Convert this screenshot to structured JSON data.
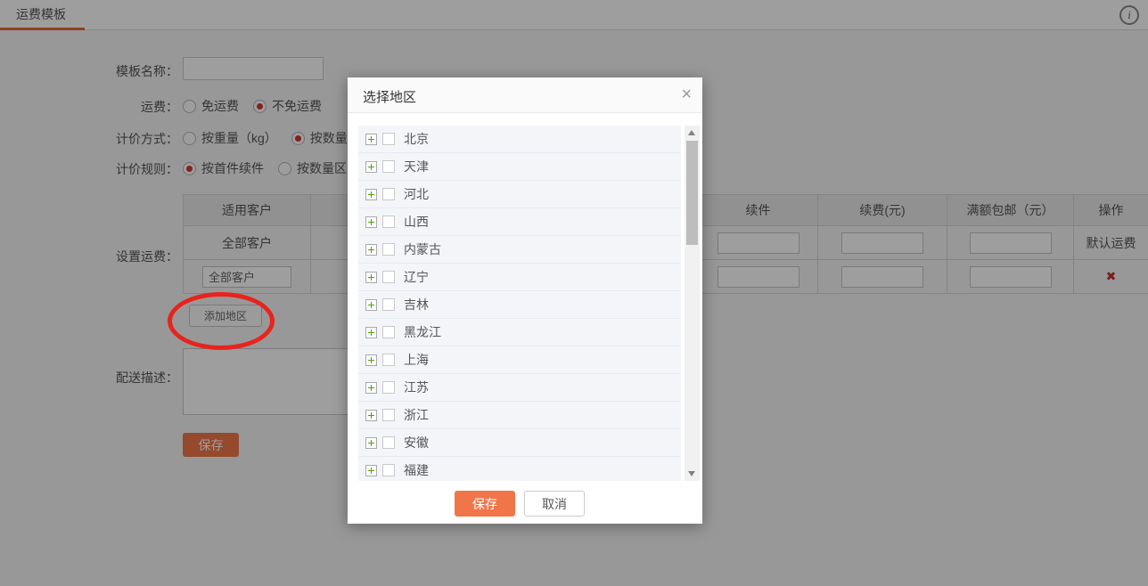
{
  "page": {
    "tab_label": "运费模板",
    "info_icon": "i"
  },
  "colors": {
    "accent_orange": "#f0764a",
    "tab_underline": "#e06a3e",
    "radio_selected": "#d5342f",
    "delete_red": "#c9302c",
    "annotation_red": "#e8231d",
    "plus_green": "#4da10e"
  },
  "form": {
    "labels": {
      "template_name": "模板名称：",
      "shipping": "运费：",
      "pricing_method": "计价方式：",
      "pricing_rule": "计价规则：",
      "set_shipping": "设置运费：",
      "delivery_desc": "配送描述："
    },
    "template_name_value": "",
    "shipping_options": [
      {
        "label": "免运费",
        "checked": false
      },
      {
        "label": "不免运费",
        "checked": true
      }
    ],
    "pricing_method_options": [
      {
        "label": "按重量（kg）",
        "checked": false
      },
      {
        "label": "按数量（",
        "checked": true
      }
    ],
    "pricing_rule_options": [
      {
        "label": "按首件续件",
        "checked": true
      },
      {
        "label": "按数量区间",
        "checked": false
      }
    ],
    "add_region_button": "添加地区",
    "save_button": "保存"
  },
  "table": {
    "headers": [
      "适用客户",
      "",
      "续件",
      "续费(元)",
      "满额包邮（元）",
      "操作"
    ],
    "row1": {
      "customer": "全部客户",
      "action": "默认运费"
    },
    "row2": {
      "customer_input_value": "全部客户",
      "delete_icon": "✖"
    }
  },
  "modal": {
    "title": "选择地区",
    "close": "×",
    "regions": [
      "北京",
      "天津",
      "河北",
      "山西",
      "内蒙古",
      "辽宁",
      "吉林",
      "黑龙江",
      "上海",
      "江苏",
      "浙江",
      "安徽",
      "福建"
    ],
    "save_button": "保存",
    "cancel_button": "取消"
  }
}
